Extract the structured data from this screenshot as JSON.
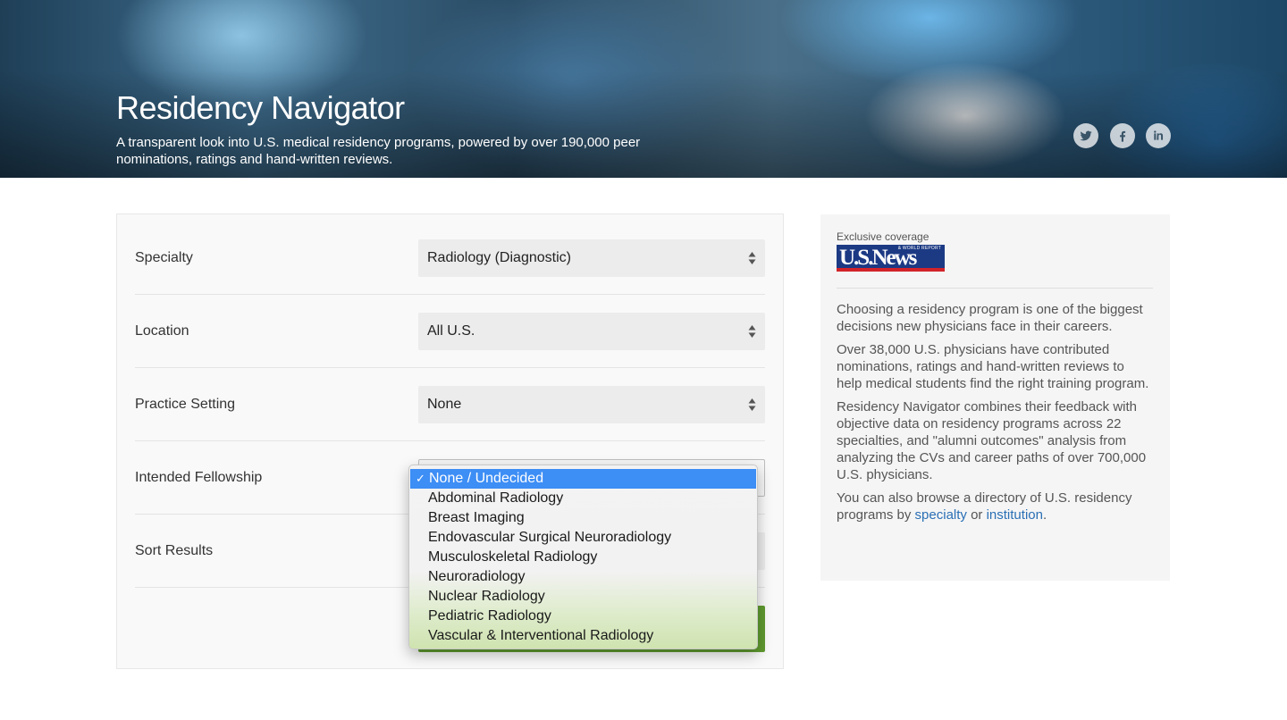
{
  "hero": {
    "title": "Residency Navigator",
    "subtitle": "A transparent look into U.S. medical residency programs, powered by over 190,000 peer nominations, ratings and hand-written reviews.",
    "social": [
      {
        "name": "twitter-icon"
      },
      {
        "name": "facebook-icon"
      },
      {
        "name": "linkedin-icon"
      }
    ]
  },
  "form": {
    "specialty": {
      "label": "Specialty",
      "value": "Radiology (Diagnostic)"
    },
    "location": {
      "label": "Location",
      "value": "All U.S."
    },
    "practice_setting": {
      "label": "Practice Setting",
      "value": "None"
    },
    "intended_fellowship": {
      "label": "Intended Fellowship",
      "selected_index": 0,
      "options": [
        "None / Undecided",
        "Abdominal Radiology",
        "Breast Imaging",
        "Endovascular Surgical Neuroradiology",
        "Musculoskeletal Radiology",
        "Neuroradiology",
        "Nuclear Radiology",
        "Pediatric Radiology",
        "Vascular & Interventional Radiology"
      ]
    },
    "sort_results": {
      "label": "Sort Results"
    }
  },
  "sidebar": {
    "exclusive": "Exclusive coverage",
    "logo_text": "U.S.News",
    "logo_small": "& WORLD REPORT",
    "p1": "Choosing a residency program is one of the biggest decisions new physicians face in their careers.",
    "p2": "Over 38,000 U.S. physicians have contributed nominations, ratings and hand-written reviews to help medical students find the right training program.",
    "p3": "Residency Navigator combines their feedback with objective data on residency programs across 22 specialties, and \"alumni outcomes\" analysis from analyzing the CVs and career paths of over 700,000 U.S. physicians.",
    "p4_before": "You can also browse a directory of U.S. residency programs by ",
    "p4_link1": "specialty",
    "p4_mid": " or ",
    "p4_link2": "institution",
    "p4_after": "."
  },
  "colors": {
    "accent_blue": "#3d8ef5",
    "link": "#2a6fb5",
    "submit_green": "#5f9a2f",
    "usnews_blue": "#1c3a84",
    "usnews_red": "#d2232a"
  }
}
